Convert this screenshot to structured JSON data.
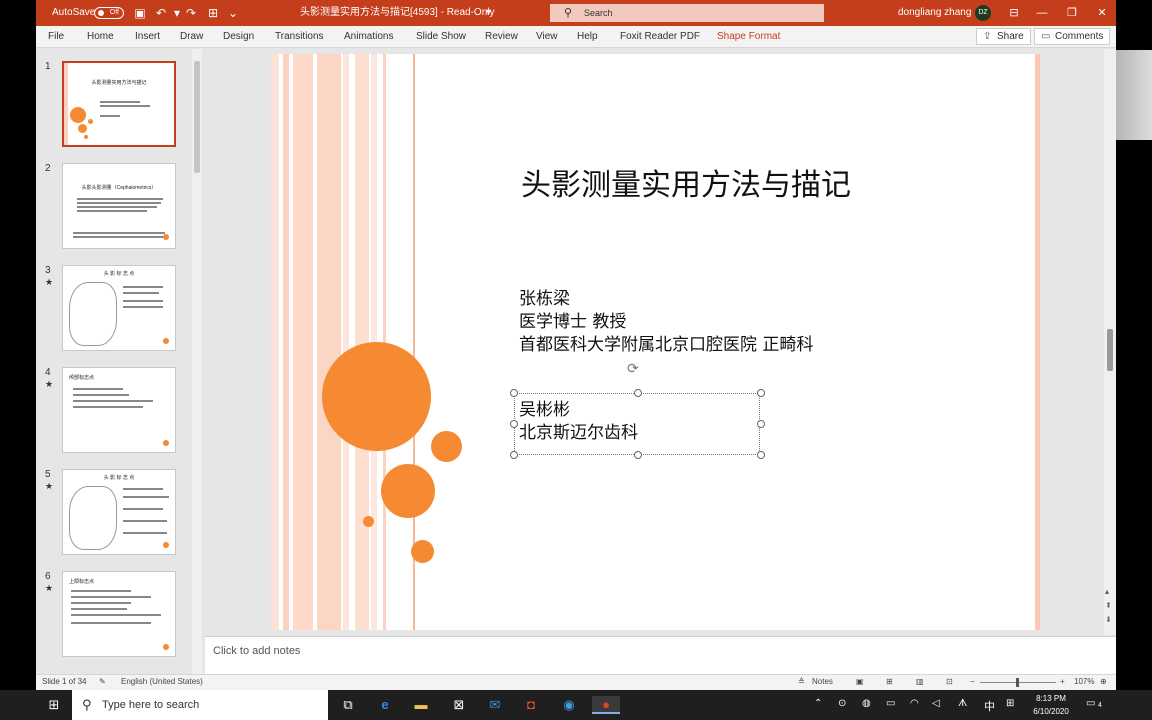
{
  "titlebar": {
    "autosave_label": "AutoSave",
    "autosave_state": "Off",
    "doc_title": "头影测量实用方法与描记[4593]  -  Read-Only",
    "title_caret": "▾",
    "search_placeholder": "Search",
    "user_name": "dongliang zhang",
    "user_initials": "DZ"
  },
  "ribbon": {
    "tabs": [
      "File",
      "Home",
      "Insert",
      "Draw",
      "Design",
      "Transitions",
      "Animations",
      "Slide Show",
      "Review",
      "View",
      "Help",
      "Foxit Reader PDF",
      "Shape Format"
    ],
    "share_label": "Share",
    "comments_label": "Comments"
  },
  "thumbnails": [
    {
      "num": "1",
      "star": "",
      "title": "头影测量实用方法与描记"
    },
    {
      "num": "2",
      "star": "",
      "title": "头影头影测量（Cephalometrics）"
    },
    {
      "num": "3",
      "star": "★",
      "title": "头 影 标 志 点"
    },
    {
      "num": "4",
      "star": "★",
      "title": "颅部标志点"
    },
    {
      "num": "5",
      "star": "★",
      "title": "头 影 标 志 点"
    },
    {
      "num": "6",
      "star": "★",
      "title": "上颌标志点"
    }
  ],
  "slide": {
    "title": "头影测量实用方法与描记",
    "author_lines": [
      "张栋梁",
      "医学博士 教授",
      "首都医科大学附属北京口腔医院 正畸科"
    ],
    "coauthor_lines": [
      "吴彬彬",
      "北京斯迈尔齿科"
    ]
  },
  "notes": {
    "placeholder": "Click to add notes"
  },
  "status": {
    "slide_info": "Slide 1 of 34",
    "language": "English (United States)",
    "notes_label": "Notes",
    "zoom": "107%"
  },
  "taskbar": {
    "search_placeholder": "Type here to search",
    "ime": "中",
    "time": "8:13 PM",
    "date": "6/10/2020",
    "notification_count": "4"
  },
  "colors": {
    "accent": "#c43e1c",
    "orange": "#f58a33",
    "stripe": "#fbd1bf"
  }
}
